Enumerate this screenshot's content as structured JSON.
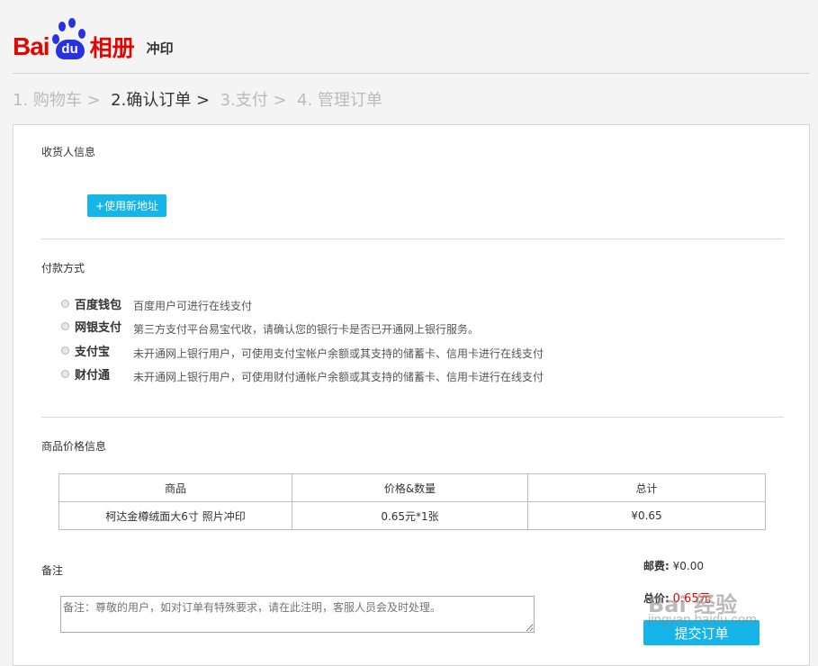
{
  "brand": {
    "logo_bai": "Bai",
    "logo_du": "du",
    "logo_album": "相册",
    "logo_print": "冲印",
    "colors": {
      "red": "#e10601",
      "blue": "#2932e1",
      "accent": "#15b5e9"
    }
  },
  "steps": [
    {
      "label": "1. 购物车 >",
      "active": false
    },
    {
      "label": "2.确认订单 >",
      "active": true
    },
    {
      "label": "3.支付 >",
      "active": false
    },
    {
      "label": "4. 管理订单",
      "active": false
    }
  ],
  "receiver": {
    "title": "收货人信息",
    "new_address_button": "+使用新地址"
  },
  "payment": {
    "title": "付款方式",
    "methods": [
      {
        "name": "百度钱包",
        "desc": "百度用户可进行在线支付"
      },
      {
        "name": "网银支付",
        "desc": "第三方支付平台易宝代收，请确认您的银行卡是否已开通网上银行服务。"
      },
      {
        "name": "支付宝",
        "desc": "未开通网上银行用户，可使用支付宝帐户余额或其支持的储蓄卡、信用卡进行在线支付"
      },
      {
        "name": "财付通",
        "desc": "未开通网上银行用户，可使用财付通帐户余额或其支持的储蓄卡、信用卡进行在线支付"
      }
    ]
  },
  "goods": {
    "title": "商品价格信息",
    "headers": [
      "商品",
      "价格&数量",
      "总计"
    ],
    "rows": [
      [
        "柯达金樽绒面大6寸 照片冲印",
        "0.65元*1张",
        "¥0.65"
      ]
    ]
  },
  "remark": {
    "title": "备注",
    "placeholder": "备注：尊敬的用户，如对订单有特殊要求，请在此注明，客服人员会及时处理。"
  },
  "summary": {
    "shipping_label": "邮费:",
    "shipping_value": "¥0.00",
    "total_label": "总价:",
    "total_value": "0.65元",
    "submit_button": "提交订单"
  },
  "watermark": {
    "mark": "Bai 经验",
    "url": "jingyan.baidu.com"
  }
}
